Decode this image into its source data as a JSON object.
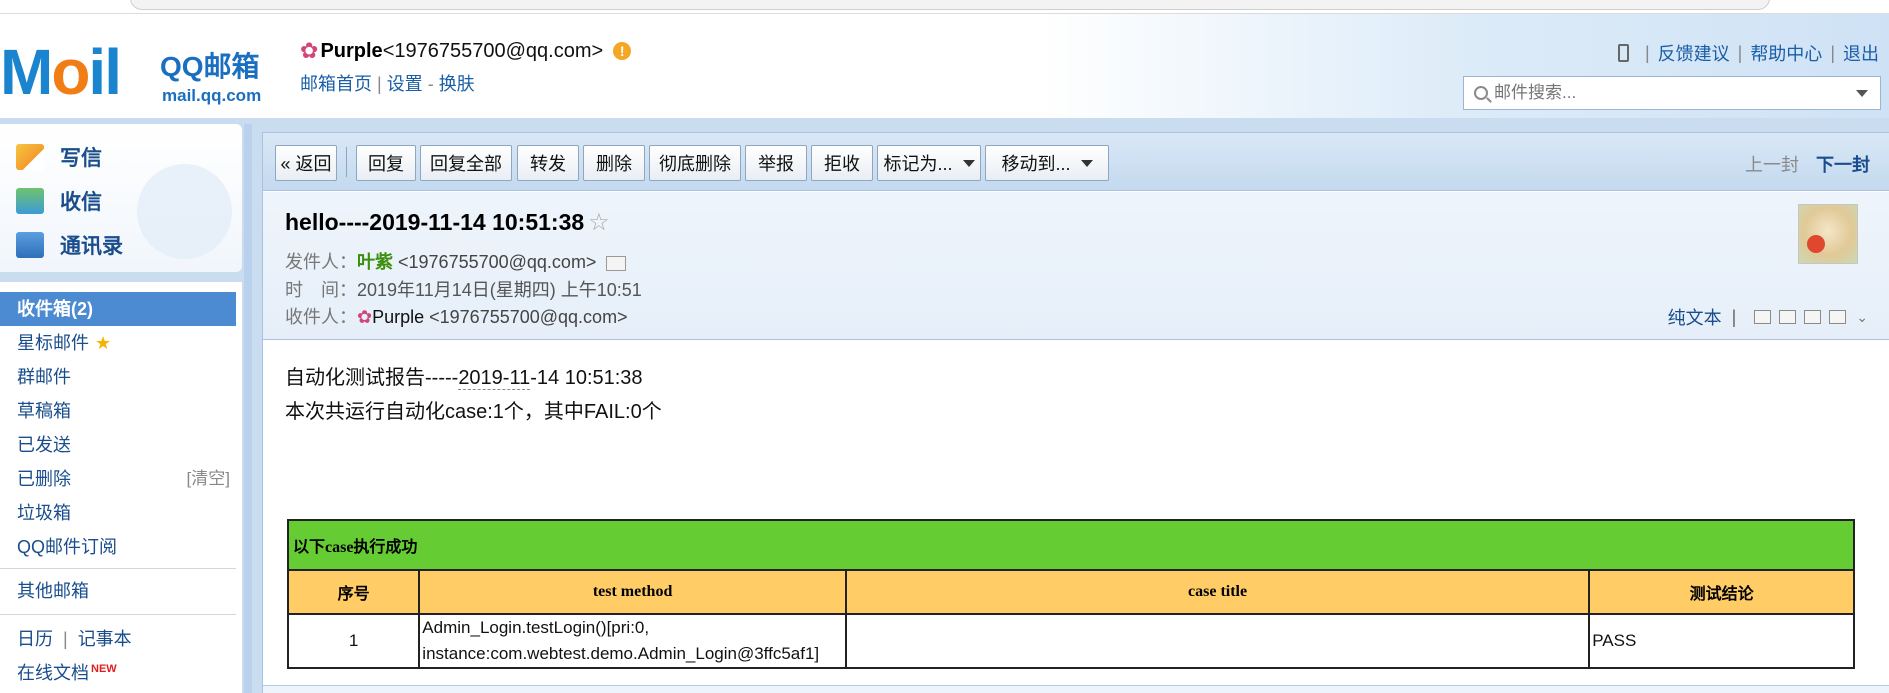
{
  "header": {
    "logo_text": "M il",
    "brand": "QQ邮箱",
    "brand_sub": "mail.qq.com",
    "account": {
      "nickname": "Purple",
      "address": "<1976755700@qq.com>",
      "warn": "!",
      "links": [
        "邮箱首页",
        "设置",
        "换肤"
      ]
    },
    "top_links": [
      "反馈建议",
      "帮助中心",
      "退出"
    ],
    "search_placeholder": "邮件搜索..."
  },
  "sidebar": {
    "quick": [
      {
        "label": "写信",
        "icon": "write-icon"
      },
      {
        "label": "收信",
        "icon": "inbox-icon"
      },
      {
        "label": "通讯录",
        "icon": "contacts-icon"
      }
    ],
    "folders": [
      {
        "label": "收件箱(2)",
        "active": true
      },
      {
        "label": "星标邮件"
      },
      {
        "label": "群邮件"
      },
      {
        "label": "草稿箱"
      },
      {
        "label": "已发送"
      },
      {
        "label": "已删除",
        "extra": "[清空]"
      },
      {
        "label": "垃圾箱"
      },
      {
        "label": "QQ邮件订阅"
      },
      {
        "label": "其他邮箱"
      },
      {
        "label": "日历"
      },
      {
        "label": "记事本"
      },
      {
        "label": "在线文档",
        "badge": "NEW"
      }
    ]
  },
  "toolbar": {
    "back": "« 返回",
    "reply": "回复",
    "reply_all": "回复全部",
    "forward": "转发",
    "delete": "删除",
    "delete_permanent": "彻底删除",
    "report": "举报",
    "reject": "拒收",
    "mark_as": "标记为...",
    "move_to": "移动到...",
    "prev": "上一封",
    "next": "下一封"
  },
  "mail": {
    "subject": "hello----2019-11-14 10:51:38",
    "from_label": "发件人：",
    "from_name": "叶紫",
    "from_email": "<1976755700@qq.com>",
    "time_label": "时　间：",
    "time_value": "2019年11月14日(星期四) 上午10:51",
    "to_label": "收件人：",
    "to_name": "Purple",
    "to_email": "<1976755700@qq.com>",
    "plain_text": "纯文本",
    "body_line1_prefix": "自动化测试报告-----",
    "body_line1_date": "2019-11",
    "body_line1_suffix": "-14 10:51:38",
    "body_line2": "本次共运行自动化case:1个，其中FAIL:0个"
  },
  "report_table": {
    "caption": "以下case执行成功",
    "headers": [
      "序号",
      "test method",
      "case title",
      "测试结论"
    ],
    "rows": [
      {
        "index": "1",
        "method_line1": "Admin_Login.testLogin()[pri:0,",
        "method_line2": "instance:com.webtest.demo.Admin_Login@3ffc5af1]",
        "title": "",
        "result": "PASS"
      }
    ],
    "colors": {
      "caption_bg": "#66cc33",
      "header_bg": "#ffcc66"
    }
  }
}
